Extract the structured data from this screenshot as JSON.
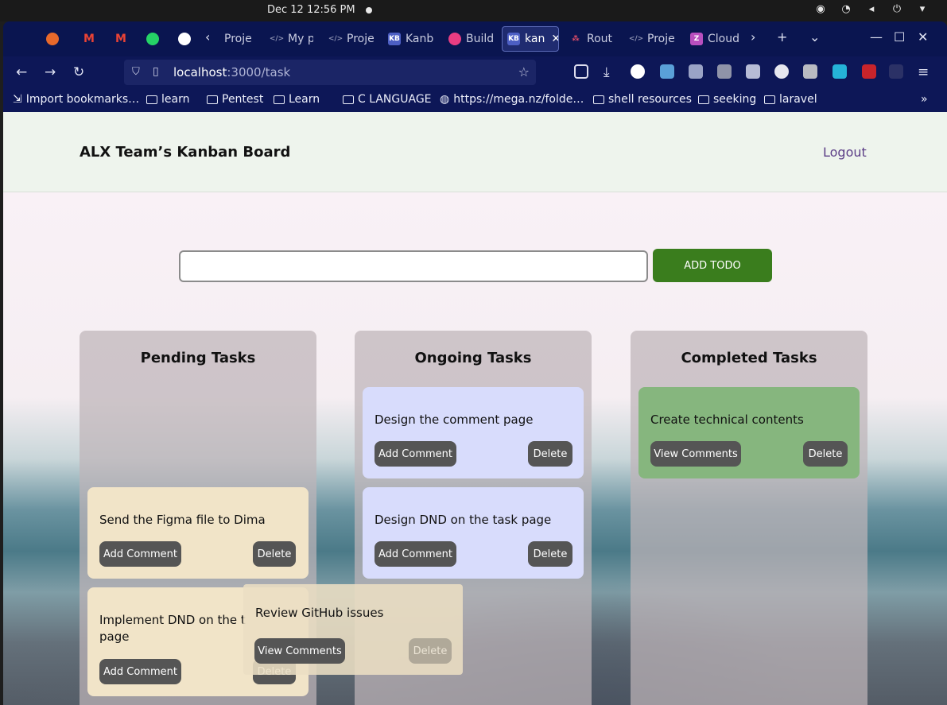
{
  "os": {
    "clock": "Dec 12  12:56 PM"
  },
  "browser": {
    "tabs": [
      {
        "label": "Proje",
        "icon": "code-tab-icon"
      },
      {
        "label": "My p",
        "icon": "code-tab-icon"
      },
      {
        "label": "Proje",
        "icon": "code-tab-icon"
      },
      {
        "label": "Kanb",
        "icon": "kb-icon"
      },
      {
        "label": "Build",
        "icon": "build-icon"
      },
      {
        "label": "kan",
        "icon": "kb-icon"
      },
      {
        "label": "Rout",
        "icon": "router-icon"
      },
      {
        "label": "Proje",
        "icon": "code-tab-icon"
      },
      {
        "label": "Cloud",
        "icon": "cloud-icon"
      }
    ],
    "url": {
      "host": "localhost",
      "path": ":3000/task"
    },
    "bookmarks": [
      "Import bookmarks…",
      "learn",
      "Pentest",
      "Learn",
      "C LANGUAGE",
      "https://mega.nz/folde…",
      "shell resources",
      "seeking",
      "laravel"
    ]
  },
  "app": {
    "title": "ALX Team’s Kanban Board",
    "logout": "Logout",
    "add_button": "ADD TODO",
    "todo_input_value": "",
    "columns": {
      "pending": {
        "title": "Pending Tasks",
        "cards": [
          {
            "text": "Send the Figma file to Dima",
            "left_button": "Add Comment",
            "right_button": "Delete"
          },
          {
            "text": "Implement DND on the t",
            "text2": "page",
            "left_button": "Add Comment",
            "right_button": "Delete"
          }
        ]
      },
      "ongoing": {
        "title": "Ongoing Tasks",
        "cards": [
          {
            "text": "Design the comment page",
            "left_button": "Add Comment",
            "right_button": "Delete"
          },
          {
            "text": "Design DND on the task page",
            "left_button": "Add Comment",
            "right_button": "Delete"
          }
        ]
      },
      "completed": {
        "title": "Completed Tasks",
        "cards": [
          {
            "text": "Create technical contents",
            "left_button": "View Comments",
            "right_button": "Delete"
          }
        ]
      }
    },
    "dragging_card": {
      "text": "Review GitHub issues",
      "left_button": "View Comments",
      "right_button": "Delete"
    }
  }
}
